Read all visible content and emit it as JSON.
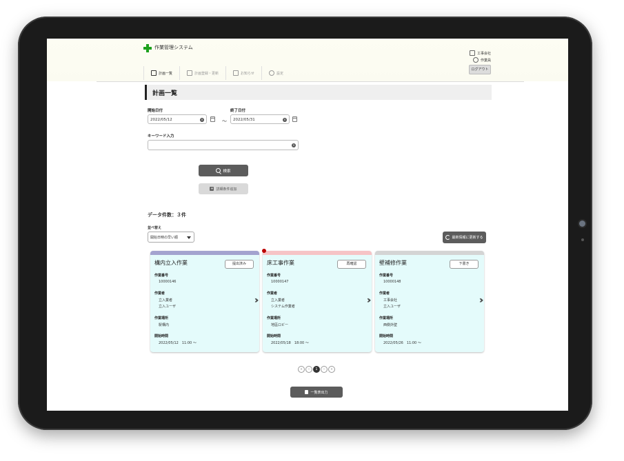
{
  "app": {
    "title": "作業管理システム",
    "company": "工事会社",
    "user_role": "作業員",
    "logout_label": "ログアウト"
  },
  "nav": {
    "items": [
      {
        "label": "計画一覧",
        "active": true
      },
      {
        "label": "計画登録・更新",
        "active": false
      },
      {
        "label": "お知らせ",
        "active": false
      },
      {
        "label": "設定",
        "active": false
      }
    ]
  },
  "page": {
    "title": "計画一覧"
  },
  "search": {
    "start_date_label": "開始日付",
    "start_date_value": "2022/05/12",
    "end_date_label": "終了日付",
    "end_date_value": "2022/05/31",
    "range_separator": "～",
    "keyword_label": "キーワード入力",
    "keyword_value": "",
    "search_button": "検索",
    "advanced_button": "詳細条件追加"
  },
  "results": {
    "count_text": "データ件数：３件",
    "sort_label": "並べ替え",
    "sort_selected": "開始日時の早い順",
    "refresh_button": "最新情報に更新する"
  },
  "cards": [
    {
      "title": "構内立入作業",
      "status": "提出済み",
      "bar_color": "#a3a3cf",
      "work_no_label": "作業番号",
      "work_no": "10000146",
      "worker_label": "作業者",
      "workers": [
        "立入業者",
        "立入ユーザ"
      ],
      "place_label": "作業場所",
      "place": "駅構内",
      "start_label": "開始時間",
      "start": "2022/05/12　11:00 ～"
    },
    {
      "title": "床工事作業",
      "status": "再確認",
      "bar_color": "#f6c4c6",
      "work_no_label": "作業番号",
      "work_no": "10000147",
      "worker_label": "作業者",
      "workers": [
        "立入業者",
        "システム作業者"
      ],
      "place_label": "作業場所",
      "place": "地區ロビー",
      "start_label": "開始時間",
      "start": "2022/05/18　18:00 ～"
    },
    {
      "title": "壁補修作業",
      "status": "下書き",
      "bar_color": "#d4d4d4",
      "work_no_label": "作業番号",
      "work_no": "10000148",
      "worker_label": "作業者",
      "workers": [
        "工事会社",
        "立入ユーザ"
      ],
      "place_label": "作業場所",
      "place": "西側外壁",
      "start_label": "開始時間",
      "start": "2022/05/26　11:00 ～"
    }
  ],
  "pagination": {
    "current_page": "1"
  },
  "export": {
    "csv_button": "一覧表出力"
  }
}
